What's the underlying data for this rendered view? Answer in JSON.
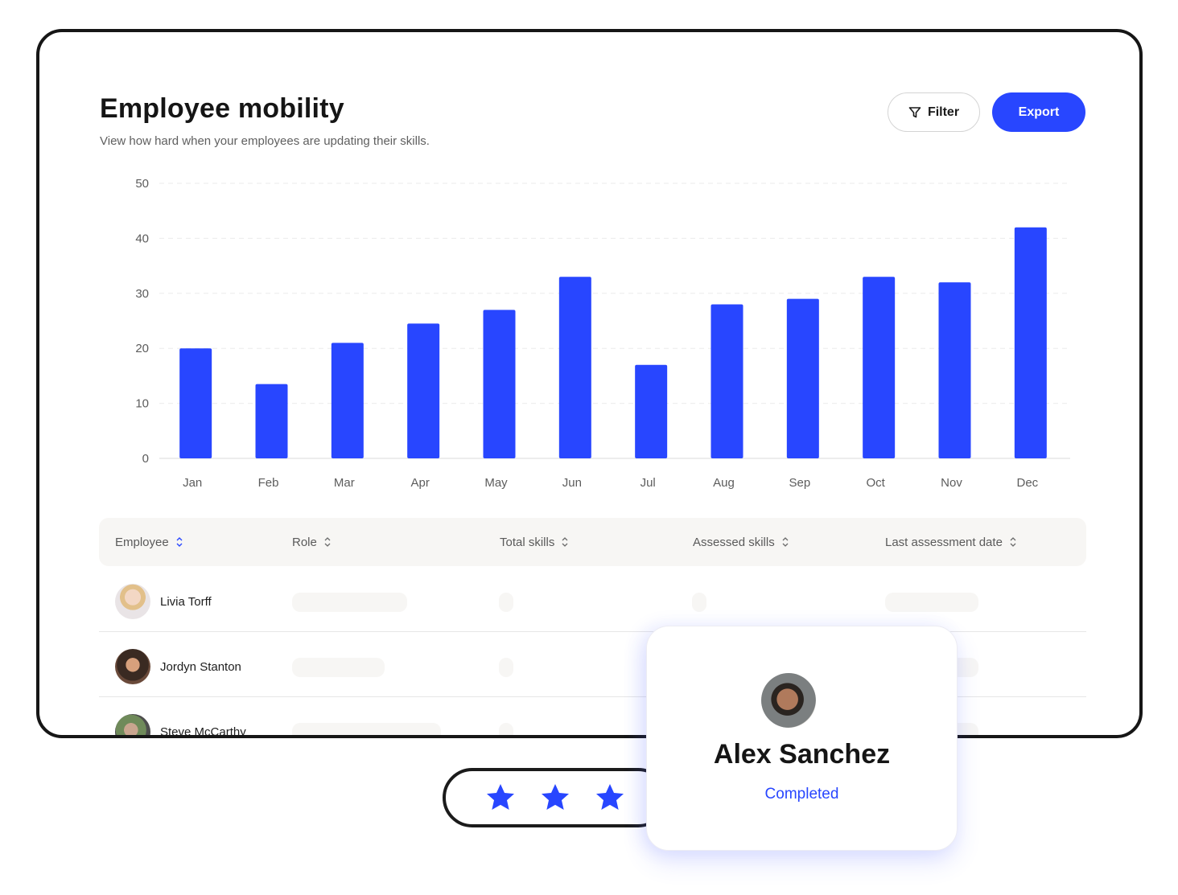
{
  "header": {
    "title": "Employee mobility",
    "subtitle": "View how hard when your employees are updating their skills.",
    "filter_label": "Filter",
    "filter_icon": "filter-funnel-icon",
    "export_label": "Export"
  },
  "colors": {
    "accent": "#2846ff",
    "bar": "#2846ff",
    "text_dark": "#151515",
    "text_muted": "#5f5f5f",
    "table_header_bg": "#f7f6f4",
    "skeleton": "#f7f6f4",
    "frame_border": "#161616"
  },
  "chart_data": {
    "type": "bar",
    "title": "",
    "xlabel": "",
    "ylabel": "",
    "categories": [
      "Jan",
      "Feb",
      "Mar",
      "Apr",
      "May",
      "Jun",
      "Jul",
      "Aug",
      "Sep",
      "Oct",
      "Nov",
      "Dec"
    ],
    "values": [
      20,
      13.5,
      21,
      24.5,
      27,
      33,
      17,
      28,
      29,
      33,
      32,
      42
    ],
    "ylim": [
      0,
      50
    ],
    "yticks": [
      0,
      10,
      20,
      30,
      40,
      50
    ],
    "grid": true,
    "legend": "none"
  },
  "table": {
    "columns": [
      {
        "label": "Employee",
        "sort_icon": "sort-updown-icon",
        "active": true
      },
      {
        "label": "Role",
        "sort_icon": "sort-updown-icon",
        "active": false
      },
      {
        "label": "Total skills",
        "sort_icon": "sort-updown-icon",
        "active": false
      },
      {
        "label": "Assessed skills",
        "sort_icon": "sort-updown-icon",
        "active": false
      },
      {
        "label": "Last assessment date",
        "sort_icon": "sort-updown-icon",
        "active": false
      }
    ],
    "rows": [
      {
        "name": "Livia Torff",
        "avatar": "avatar-photo"
      },
      {
        "name": "Jordyn Stanton",
        "avatar": "avatar-photo"
      },
      {
        "name": "Steve McCarthy",
        "avatar": "avatar-photo"
      }
    ]
  },
  "profile_card": {
    "name": "Alex Sanchez",
    "status": "Completed",
    "avatar": "avatar-photo"
  },
  "rating": {
    "stars": 3,
    "max": 3,
    "icon": "star-icon"
  }
}
